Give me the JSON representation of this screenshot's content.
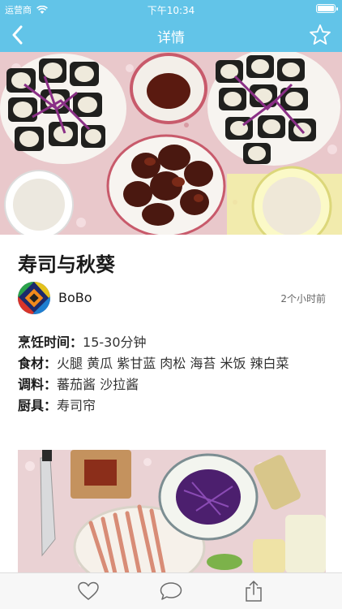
{
  "status_bar": {
    "carrier": "运营商",
    "time": "下午10:34"
  },
  "nav": {
    "title": "详情",
    "back_icon": "chevron-left-icon",
    "favorite_icon": "star-outline-icon"
  },
  "recipe": {
    "title": "寿司与秋葵",
    "author": "BoBo",
    "posted": "2个小时前",
    "details": [
      {
        "label": "烹饪时间：",
        "value": "15-30分钟"
      },
      {
        "label": "食材：",
        "value": "火腿 黄瓜 紫甘蓝 肉松 海苔 米饭 辣白菜"
      },
      {
        "label": "调料：",
        "value": "蕃茄酱 沙拉酱"
      },
      {
        "label": "厨具：",
        "value": "寿司帘"
      }
    ]
  },
  "toolbar": {
    "like_icon": "heart-icon",
    "comment_icon": "comment-icon",
    "share_icon": "share-icon"
  },
  "colors": {
    "nav_bg": "#62c4e8",
    "toolbar_bg": "#f7f7f7"
  }
}
